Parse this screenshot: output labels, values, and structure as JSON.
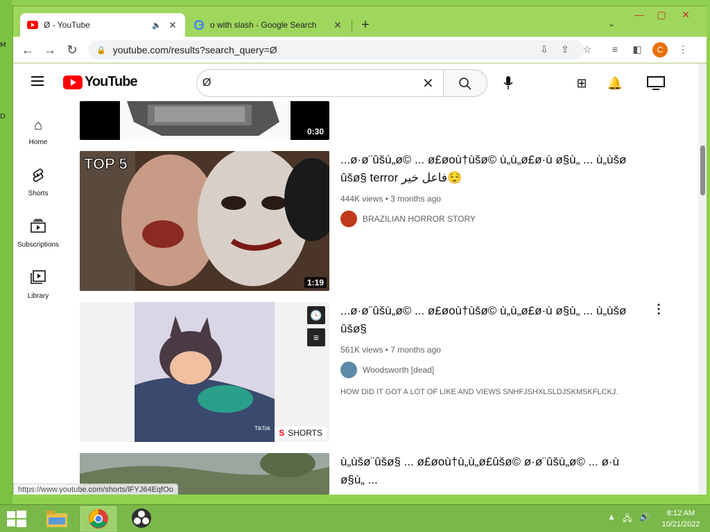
{
  "desktop": {
    "glyphs": [
      "M",
      "D"
    ]
  },
  "browser": {
    "tabs": [
      {
        "title": "Ø - YouTube",
        "active": true
      },
      {
        "title": "o with slash - Google Search",
        "active": false
      }
    ],
    "new_tab": "+",
    "address": "youtube.com/results?search_query=Ø",
    "profile_initial": "C"
  },
  "youtube": {
    "logo_text": "YouTube",
    "search_value": "Ø",
    "rail": [
      {
        "label": "Home",
        "icon": "home-icon"
      },
      {
        "label": "Shorts",
        "icon": "shorts-icon"
      },
      {
        "label": "Subscriptions",
        "icon": "subscriptions-icon"
      },
      {
        "label": "Library",
        "icon": "library-icon"
      }
    ],
    "results": [
      {
        "duration": "0:30"
      },
      {
        "duration": "1:19",
        "thumb_text": "TOP 5",
        "title": "...ø·ø¨ûšù„ø© ... ø£øoù†ùšø© ù„ù„ø£ø·ù ø§ù„ ... ù„ùšø ûšø§ terror فاعل خير😌",
        "meta": "444K views • 3 months ago",
        "channel": "BRAZILIAN HORROR STORY"
      },
      {
        "title": "...ø·ø¨ûšù„ø© ... ø£øoù†ùšø© ù„ù„ø£ø·ù ø§ù„ ... ù„ùšø ûšø§",
        "meta": "561K views • 7 months ago",
        "channel": "Woodsworth [dead]",
        "description": "HOW DID IT GOT A LOT OF LIKE AND VIEWS SNHFJSHXLSLDJSKMSKFLCKJ.",
        "badge": "SHORTS",
        "tiktok": "TikTok"
      },
      {
        "title": "ù„ùšø¨ûšø§ ... ø£øoù†ù„ù„ø£ûšø© ø·ø¨ûšù„ø© ... ø·ù ø§ù„ ..."
      }
    ],
    "status_url": "https://www.youtube.com/shorts/lFYJ64EqfOo"
  },
  "taskbar": {
    "time": "8:12 AM",
    "date": "10/21/2022"
  }
}
